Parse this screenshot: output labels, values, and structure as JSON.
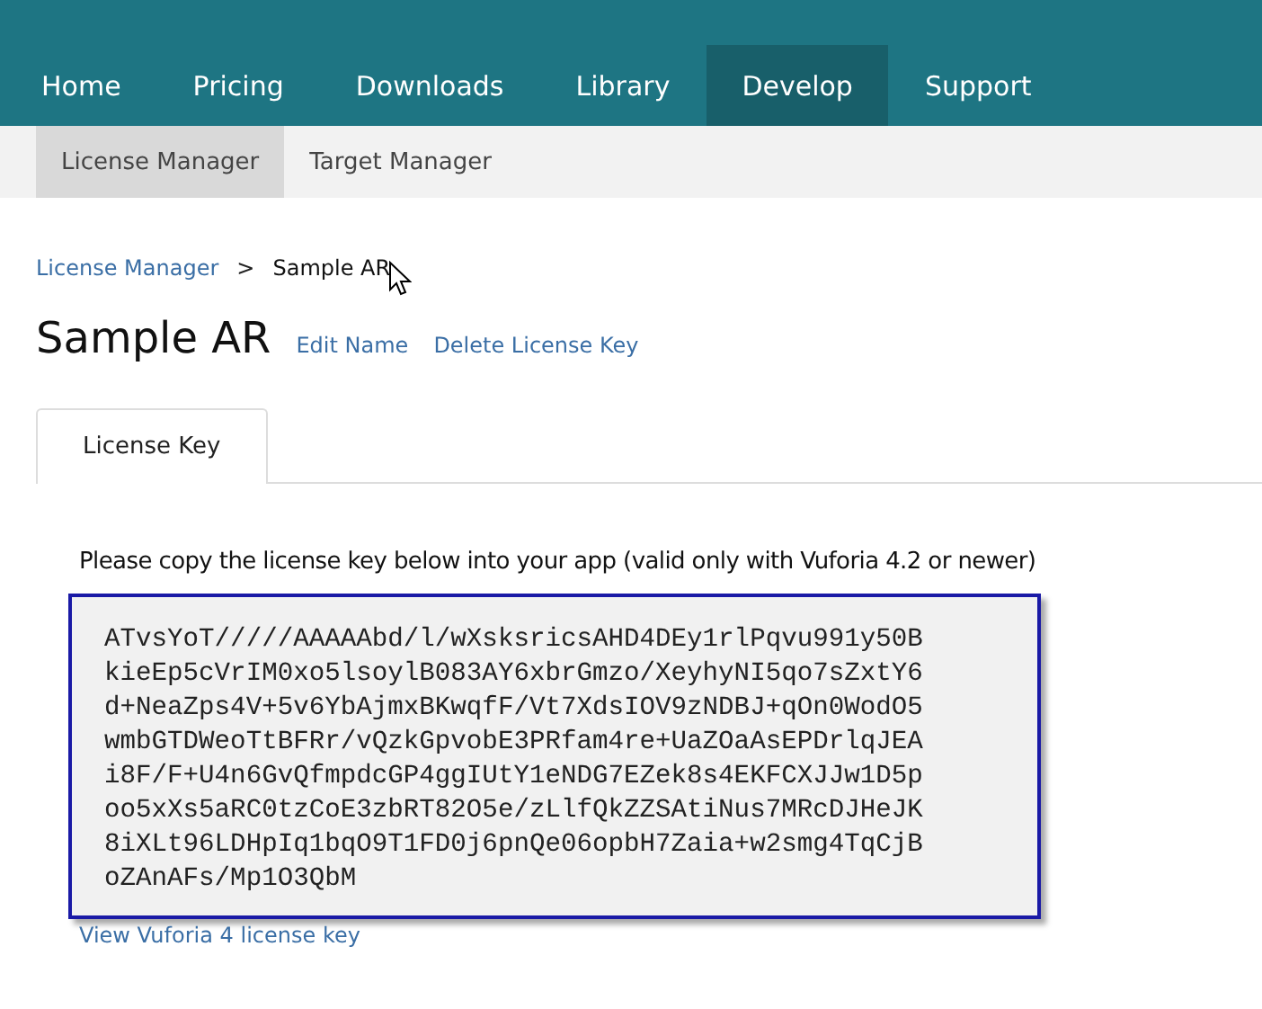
{
  "nav": [
    {
      "label": "Home",
      "selected": false
    },
    {
      "label": "Pricing",
      "selected": false
    },
    {
      "label": "Downloads",
      "selected": false
    },
    {
      "label": "Library",
      "selected": false
    },
    {
      "label": "Develop",
      "selected": true
    },
    {
      "label": "Support",
      "selected": false
    }
  ],
  "subnav": [
    {
      "label": "License Manager",
      "selected": true
    },
    {
      "label": "Target Manager",
      "selected": false
    }
  ],
  "breadcrumb": {
    "link": "License Manager",
    "separator": ">",
    "current": "Sample AR"
  },
  "title": "Sample AR",
  "actions": [
    "Edit Name",
    "Delete License Key"
  ],
  "tabs": [
    {
      "label": "License Key",
      "selected": true
    }
  ],
  "instruction": "Please copy the license key below into your app (valid only with Vuforia 4.2 or newer)",
  "license_key_lines": [
    "ATvsYoT/////AAAAAbd/l/wXsksricsAHD4DEy1rlPqvu991y50B",
    "kieEp5cVrIM0xo5lsoylB083AY6xbrGmzo/XeyhyNI5qo7sZxtY6",
    "d+NeaZps4V+5v6YbAjmxBKwqfF/Vt7XdsIOV9zNDBJ+qOn0WodO5",
    "wmbGTDWeoTtBFRr/vQzkGpvobE3PRfam4re+UaZOaAsEPDrlqJEA",
    "i8F/F+U4n6GvQfmpdcGP4ggIUtY1eNDG7EZek8s4EKFCXJJw1D5p",
    "oo5xXs5aRC0tzCoE3zbRT82O5e/zLlfQkZZSAtiNus7MRcDJHeJK",
    "8iXLt96LDHpIq1bqO9T1FD0j6pnQe06opbH7Zaia+w2smg4TqCjB",
    "oZAnAFs/Mp1O3QbM"
  ],
  "footer_link": "View Vuforia 4 license key"
}
